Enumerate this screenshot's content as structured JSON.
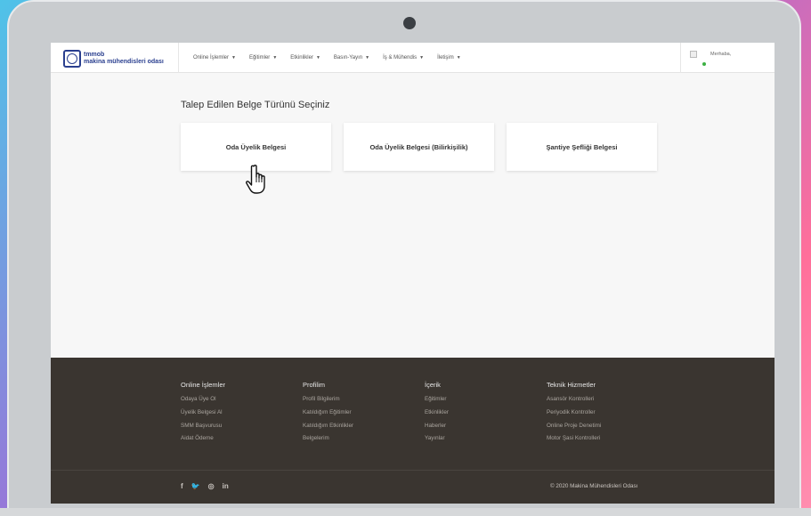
{
  "navbar": {
    "logo_line1": "tmmob",
    "logo_line2": "makina mühendisleri odası",
    "menu": [
      {
        "label": "Online İşlemler"
      },
      {
        "label": "Eğitimler"
      },
      {
        "label": "Etkinlikler"
      },
      {
        "label": "Basın-Yayın"
      },
      {
        "label": "İş & Mühendis"
      },
      {
        "label": "İletişim"
      }
    ],
    "greeting": "Merhaba,"
  },
  "main": {
    "title": "Talep Edilen Belge Türünü Seçiniz",
    "cards": [
      {
        "label": "Oda Üyelik Belgesi"
      },
      {
        "label": "Oda Üyelik Belgesi (Bilirkişilik)"
      },
      {
        "label": "Şantiye Şefliği Belgesi"
      }
    ]
  },
  "footer": {
    "columns": [
      {
        "title": "Online İşlemler",
        "links": [
          "Odaya Üye Ol",
          "Üyelik Belgesi Al",
          "SMM Başvurusu",
          "Aidat Ödeme"
        ]
      },
      {
        "title": "Profilim",
        "links": [
          "Profil Bilgilerim",
          "Katıldığım Eğitimler",
          "Katıldığım Etkinlikler",
          "Belgelerim"
        ]
      },
      {
        "title": "İçerik",
        "links": [
          "Eğitimler",
          "Etkinlikler",
          "Haberler",
          "Yayınlar"
        ]
      },
      {
        "title": "Teknik Hizmetler",
        "links": [
          "Asansör Kontrolleri",
          "Periyodik Kontroller",
          "Online Proje Denetimi",
          "Motor Şasi Kontrolleri"
        ]
      }
    ],
    "social": {
      "facebook": "f",
      "twitter": "🐦",
      "instagram": "◎",
      "linkedin": "in"
    },
    "copyright": "© 2020 Makina Mühendisleri Odası"
  },
  "colors": {
    "footer_bg": "#3a3530",
    "brand": "#2a3f8f",
    "online": "#3cb043"
  }
}
